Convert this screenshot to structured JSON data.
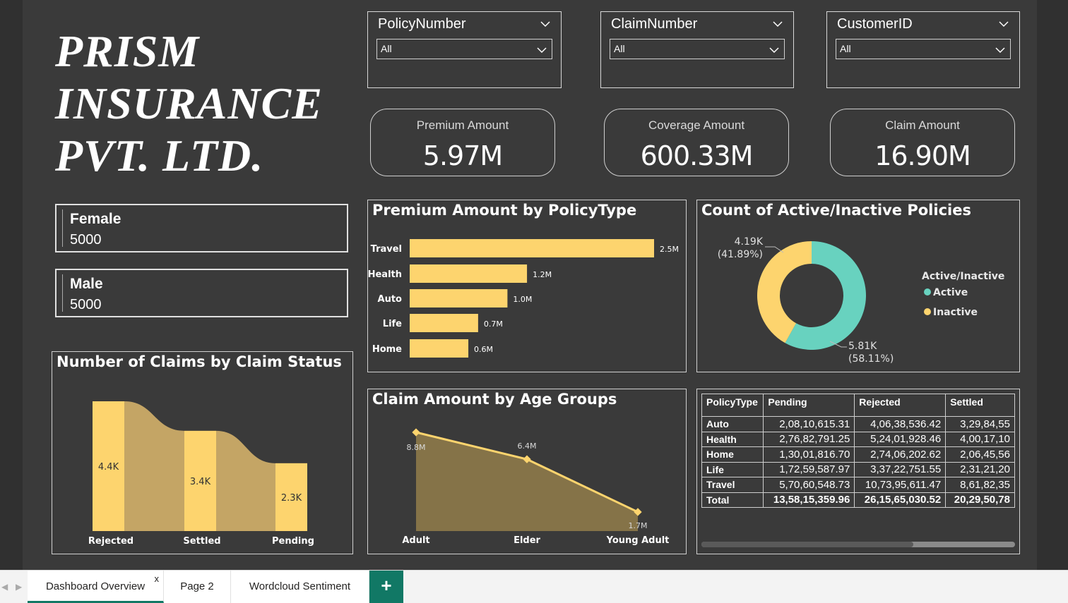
{
  "header": {
    "title_lines": [
      "PRISM",
      "INSURANCE",
      "PVT. LTD."
    ]
  },
  "slicers": [
    {
      "label": "PolicyNumber",
      "value": "All"
    },
    {
      "label": "ClaimNumber",
      "value": "All"
    },
    {
      "label": "CustomerID",
      "value": "All"
    }
  ],
  "kpis": [
    {
      "label": "Premium Amount",
      "value": "5.97M"
    },
    {
      "label": "Coverage Amount",
      "value": "600.33M"
    },
    {
      "label": "Claim Amount",
      "value": "16.90M"
    }
  ],
  "gender_cards": [
    {
      "label": "Female",
      "value": "5000"
    },
    {
      "label": "Male",
      "value": "5000"
    }
  ],
  "colors": {
    "accent_yellow": "#fdd46e",
    "teal": "#68d2bf",
    "ribbon": "#c4a565",
    "area": "#857348",
    "tab_green": "#117865"
  },
  "chart_data": [
    {
      "type": "bar",
      "title": "Premium Amount by PolicyType",
      "categories": [
        "Travel",
        "Health",
        "Auto",
        "Life",
        "Home"
      ],
      "values": [
        2.5,
        1.2,
        1.0,
        0.7,
        0.6
      ],
      "value_labels": [
        "2.5M",
        "1.2M",
        "1.0M",
        "0.7M",
        "0.6M"
      ],
      "orientation": "horizontal"
    },
    {
      "type": "pie",
      "title": "Count of Active/Inactive Policies",
      "legend_title": "Active/Inactive",
      "legend_position": "right",
      "slices": [
        {
          "name": "Active",
          "value": 5.81,
          "label": "5.81K",
          "pct": "(58.11%)"
        },
        {
          "name": "Inactive",
          "value": 4.19,
          "label": "4.19K",
          "pct": "(41.89%)"
        }
      ]
    },
    {
      "type": "bar",
      "title": "Number of Claims by Claim Status",
      "categories": [
        "Rejected",
        "Settled",
        "Pending"
      ],
      "values": [
        4.4,
        3.4,
        2.3
      ],
      "value_labels": [
        "4.4K",
        "3.4K",
        "2.3K"
      ],
      "variant": "ribbon"
    },
    {
      "type": "area",
      "title": "Claim Amount by Age Groups",
      "categories": [
        "Adult",
        "Elder",
        "Young Adult"
      ],
      "values": [
        8.8,
        6.4,
        1.7
      ],
      "value_labels": [
        "8.8M",
        "6.4M",
        "1.7M"
      ]
    }
  ],
  "matrix": {
    "columns": [
      "PolicyType",
      "Pending",
      "Rejected",
      "Settled"
    ],
    "rows": [
      [
        "Auto",
        "2,08,10,615.31",
        "4,06,38,536.42",
        "3,29,84,55"
      ],
      [
        "Health",
        "2,76,82,791.25",
        "5,24,01,928.46",
        "4,00,17,10"
      ],
      [
        "Home",
        "1,30,01,816.70",
        "2,74,06,202.62",
        "2,06,45,56"
      ],
      [
        "Life",
        "1,72,59,587.97",
        "3,37,22,751.55",
        "2,31,21,20"
      ],
      [
        "Travel",
        "5,70,60,548.73",
        "10,73,95,611.47",
        "8,61,82,35"
      ],
      [
        "Total",
        "13,58,15,359.96",
        "26,15,65,030.52",
        "20,29,50,78"
      ]
    ]
  },
  "tabs": [
    {
      "label": "Dashboard Overview",
      "close": "x"
    },
    {
      "label": "Page 2"
    },
    {
      "label": "Wordcloud Sentiment"
    }
  ],
  "add_tab": "+"
}
